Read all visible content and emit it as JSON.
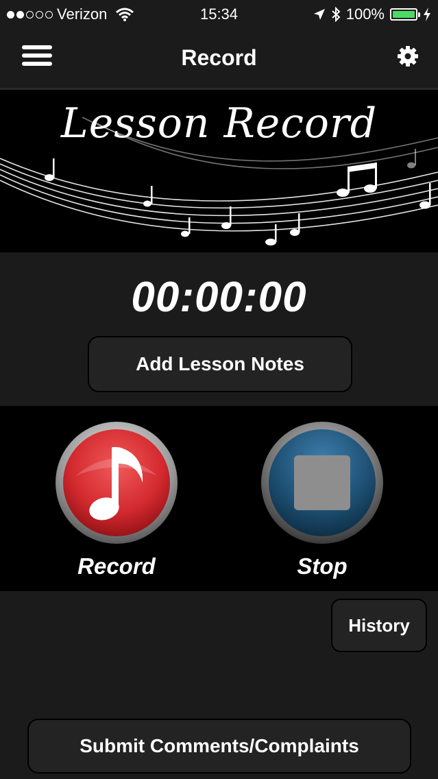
{
  "status_bar": {
    "carrier": "Verizon",
    "time": "15:34",
    "battery": "100%",
    "signal_bars_filled": 2,
    "signal_bars_total": 5
  },
  "nav": {
    "title": "Record",
    "menu_icon": "hamburger-menu-icon",
    "settings_icon": "gear-icon"
  },
  "banner": {
    "title": "Lesson Record"
  },
  "timer": "00:00:00",
  "buttons": {
    "add_notes": "Add Lesson Notes",
    "record": "Record",
    "stop": "Stop",
    "history": "History",
    "submit": "Submit Comments/Complaints"
  },
  "colors": {
    "record": "#d42a2f",
    "stop": "#1d4f72",
    "battery": "#4cd964",
    "background": "#1b1b1b"
  }
}
